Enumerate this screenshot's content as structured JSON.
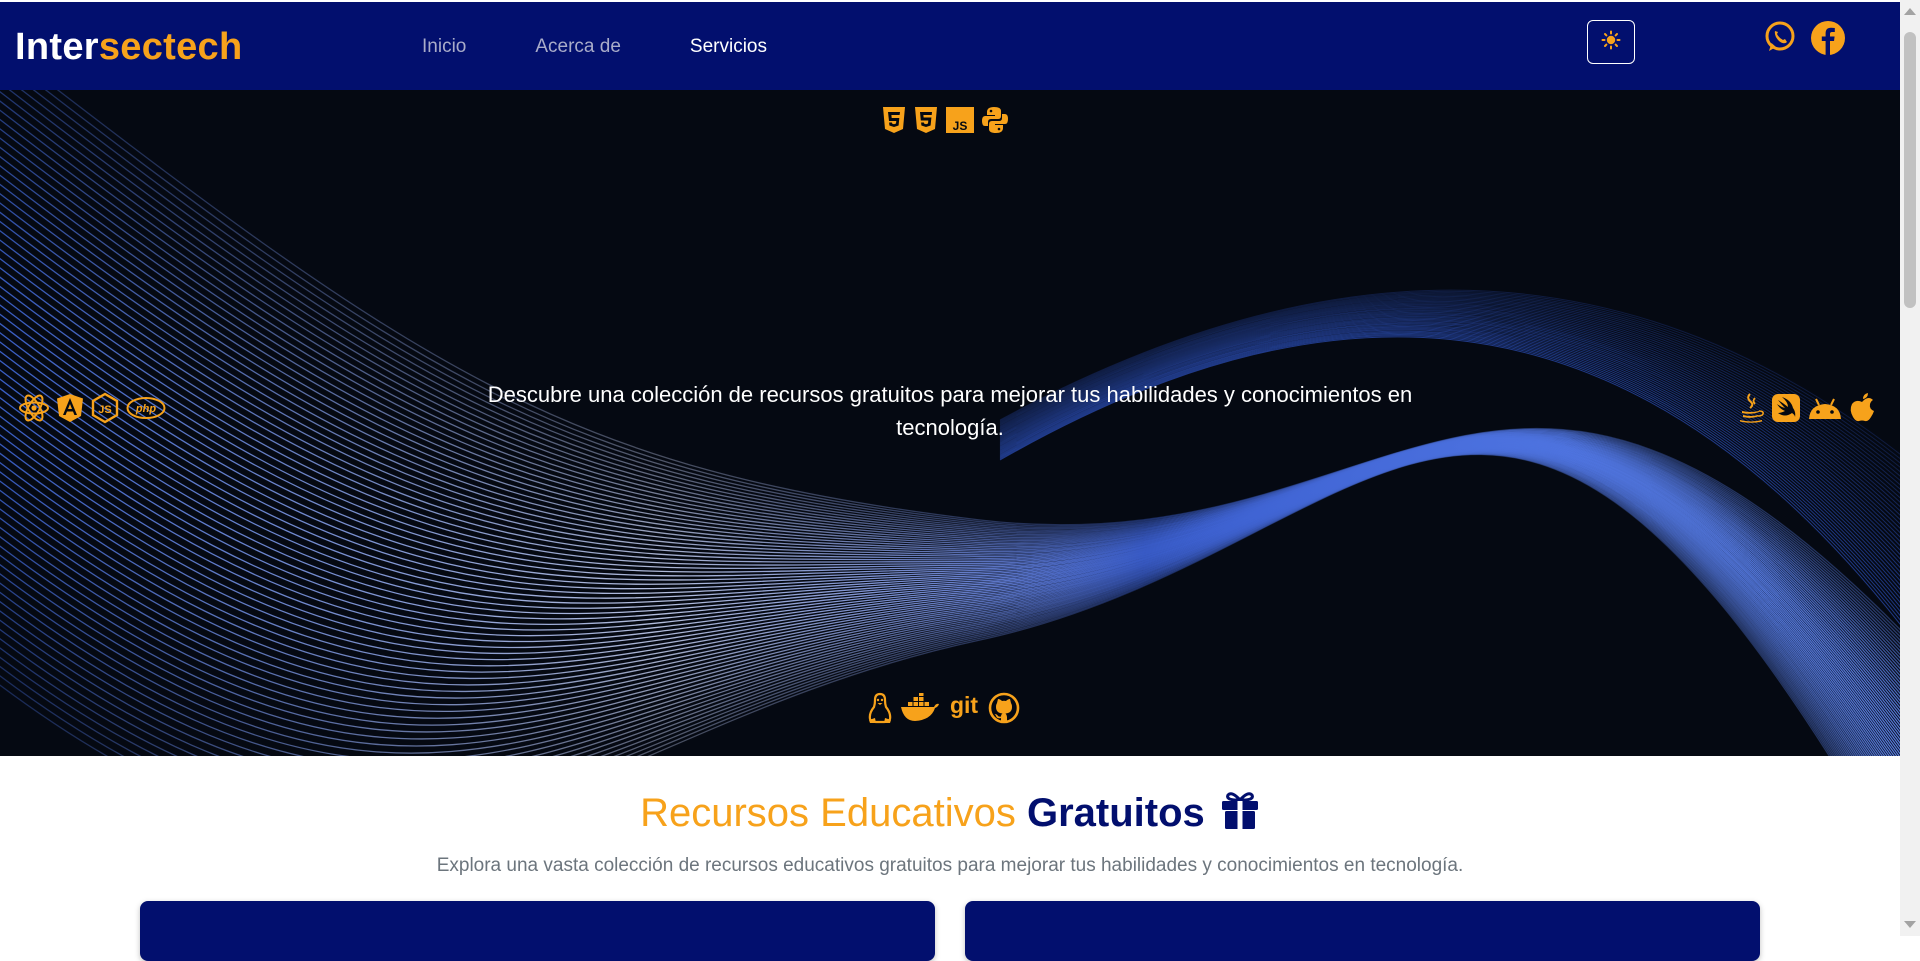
{
  "brand": {
    "part1": "Inter",
    "part2": "sectech"
  },
  "nav": {
    "items": [
      {
        "label": "Inicio"
      },
      {
        "label": "Acerca de"
      },
      {
        "label": "Servicios"
      }
    ]
  },
  "header_actions": {
    "theme_toggle_icon": "sun-icon",
    "social_icons": [
      "whatsapp-icon",
      "facebook-icon"
    ]
  },
  "hero": {
    "text": "Descubre una colección de recursos gratuitos para mejorar tus habilidades y conocimientos en tecnología.",
    "icons_top": [
      "html5-icon",
      "css3-icon",
      "js-icon",
      "python-icon"
    ],
    "icons_left": [
      "react-icon",
      "angular-icon",
      "nodejs-icon",
      "php-icon"
    ],
    "icons_right": [
      "java-icon",
      "swift-icon",
      "android-icon",
      "apple-icon"
    ],
    "icons_bottom": [
      "linux-icon",
      "docker-icon",
      "git-icon",
      "github-icon"
    ],
    "git_label": "git",
    "php_label": "php",
    "js_label": "JS"
  },
  "section": {
    "title_part1": "Recursos Educativos",
    "title_part2": "Gratuitos",
    "title_icon": "gift-icon",
    "subtitle": "Explora una vasta colección de recursos educativos gratuitos para mejorar tus habilidades y conocimientos en tecnología."
  },
  "colors": {
    "navbar": "#020f6e",
    "accent": "#f7a21b",
    "hero_bg": "#050912",
    "text_muted": "#6c757d"
  }
}
